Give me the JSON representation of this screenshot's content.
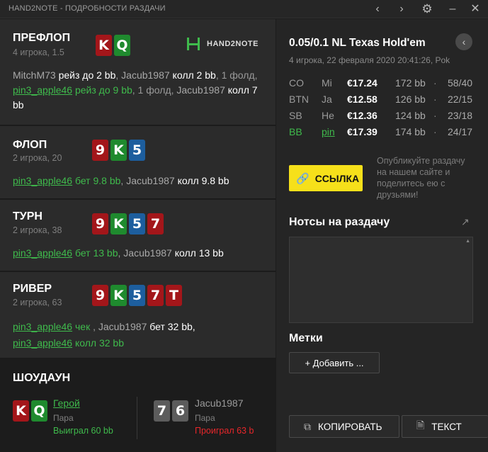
{
  "window": {
    "title": "HAND2NOTE - ПОДРОБНОСТИ РАЗДАЧИ"
  },
  "titlebar_icons": [
    "chevron-left-icon",
    "chevron-right-icon",
    "gear-icon",
    "minimize-icon",
    "close-icon"
  ],
  "logo": {
    "text": "HAND2NOTE"
  },
  "streets": {
    "preflop": {
      "name": "ПРЕФЛОП",
      "sub": "4 игрока, 1.5",
      "cards": [
        {
          "rank": "K",
          "color": "r"
        },
        {
          "rank": "Q",
          "color": "g"
        }
      ]
    },
    "flop": {
      "name": "ФЛОП",
      "sub": "2 игрока, 20",
      "cards": [
        {
          "rank": "9",
          "color": "r"
        },
        {
          "rank": "K",
          "color": "g"
        },
        {
          "rank": "5",
          "color": "b"
        }
      ]
    },
    "turn": {
      "name": "ТУРН",
      "sub": "2 игрока, 38",
      "cards": [
        {
          "rank": "9",
          "color": "r"
        },
        {
          "rank": "K",
          "color": "g"
        },
        {
          "rank": "5",
          "color": "b"
        },
        {
          "rank": "7",
          "color": "r"
        }
      ]
    },
    "river": {
      "name": "РИВЕР",
      "sub": "2 игрока, 63",
      "cards": [
        {
          "rank": "9",
          "color": "r"
        },
        {
          "rank": "K",
          "color": "g"
        },
        {
          "rank": "5",
          "color": "b"
        },
        {
          "rank": "7",
          "color": "r"
        },
        {
          "rank": "T",
          "color": "r"
        }
      ]
    }
  },
  "actions": {
    "preflop": {
      "p1": "MitchM73",
      "a1": " рейз до 2 bb",
      "sep1": ", ",
      "p2": "Jacub1987",
      "a2": " колл 2 bb",
      "m1": ", 1 фолд, ",
      "hero": "pin3_apple46",
      "a3": " рейз до 9 bb",
      "m2": ", 1 фолд, ",
      "p3": "Jacub1987",
      "a4": " колл 7 bb"
    },
    "flop": {
      "hero": "pin3_apple46",
      "a1": " бет 9.8 bb",
      "sep": ", ",
      "p1": "Jacub1987",
      "a2": " колл 9.8 bb"
    },
    "turn": {
      "hero": "pin3_apple46",
      "a1": " бет 13 bb",
      "sep": ", ",
      "p1": "Jacub1987",
      "a2": " колл 13 bb"
    },
    "river": {
      "hero": "pin3_apple46",
      "a1": " чек",
      "sep": " , ",
      "p1": "Jacub1987",
      "a2": " бет 32 bb,",
      "hero2": "pin3_apple46",
      "a3": " колл 32 bb"
    }
  },
  "showdown": {
    "title": "ШОУДАУН",
    "hero": {
      "cards": [
        {
          "rank": "K",
          "color": "r"
        },
        {
          "rank": "Q",
          "color": "g"
        }
      ],
      "name": "Герой",
      "hand": "Пара",
      "result": "Выиграл 60 bb",
      "result_color": "#3fba4c"
    },
    "villain": {
      "cards": [
        {
          "rank": "7",
          "color": "gr"
        },
        {
          "rank": "6",
          "color": "gr"
        }
      ],
      "name": "Jacub1987",
      "hand": "Пара",
      "result": "Проиграл 63 b",
      "result_color": "#e8262a"
    }
  },
  "game": {
    "title": "0.05/0.1 NL Texas Hold'em",
    "subtitle": "4 игрока, 22 февраля 2020 20:41:26, Pok"
  },
  "players": [
    {
      "pos": "CO",
      "name": "Mi",
      "stack": "€17.24",
      "bb": "172 bb",
      "dot": "·",
      "stat": "58/40",
      "hero": false
    },
    {
      "pos": "BTN",
      "name": "Ja",
      "stack": "€12.58",
      "bb": "126 bb",
      "dot": "·",
      "stat": "22/15",
      "hero": false
    },
    {
      "pos": "SB",
      "name": "Не",
      "stack": "€12.36",
      "bb": "124 bb",
      "dot": "·",
      "stat": "23/18",
      "hero": false
    },
    {
      "pos": "BB",
      "name": "pin",
      "stack": "€17.39",
      "bb": "174 bb",
      "dot": "·",
      "stat": "24/17",
      "hero": true
    }
  ],
  "share": {
    "button": "ССЫЛКА",
    "text": "Опубликуйте раздачу на нашем сайте и поделитесь ею с друзьями!"
  },
  "notes": {
    "title": "Нотсы на раздачу",
    "value": ""
  },
  "tags": {
    "title": "Метки",
    "add_button": "+  Добавить ..."
  },
  "bottom": {
    "copy": "КОПИРОВАТЬ",
    "text": "ТЕКСТ"
  },
  "colors": {
    "accent_green": "#3fba4c",
    "accent_yellow": "#f6e01a",
    "loss_red": "#e8262a"
  }
}
